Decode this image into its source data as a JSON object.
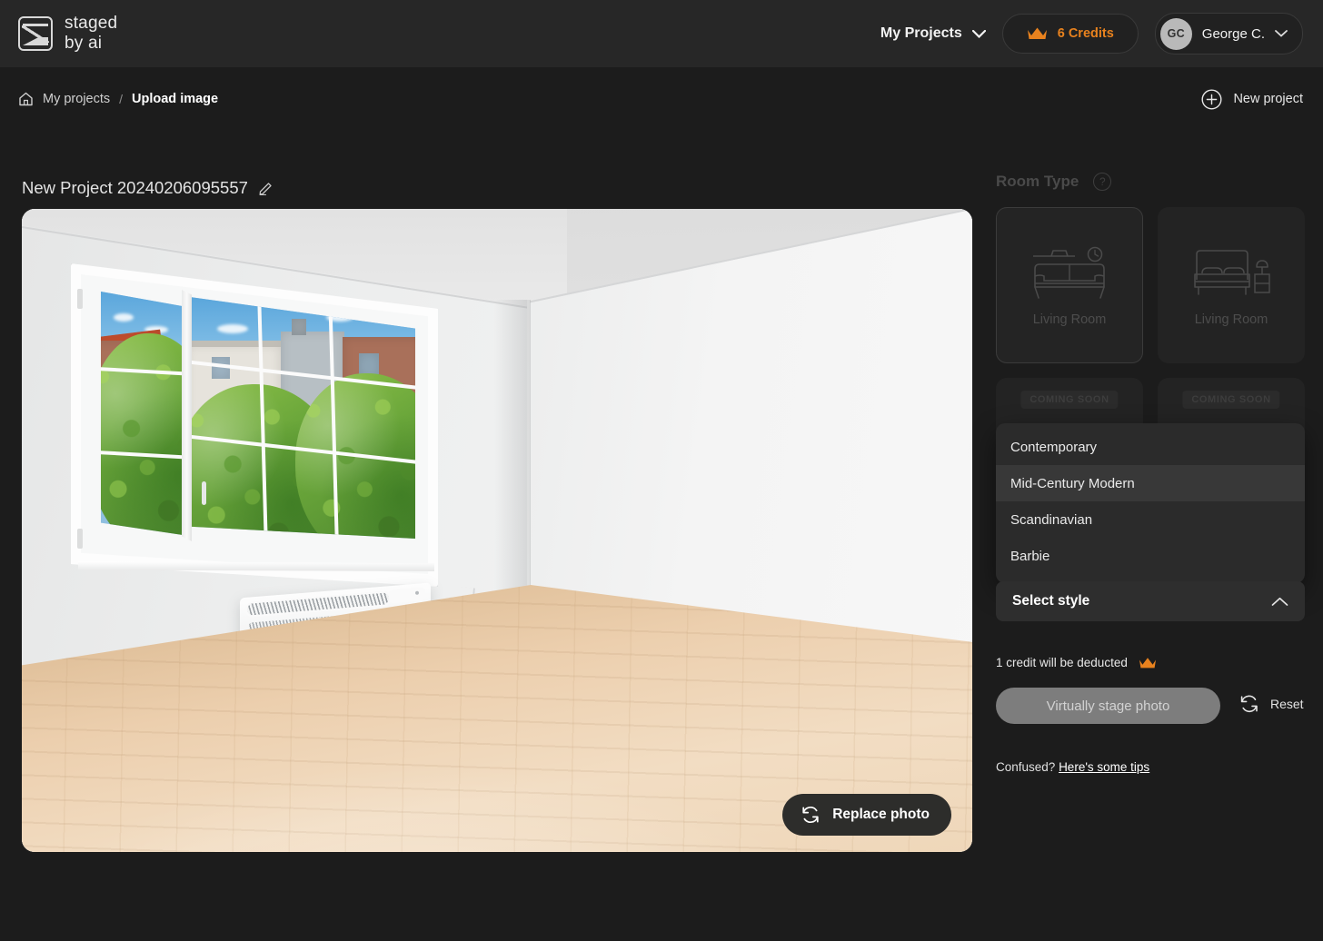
{
  "topbar": {
    "logo_line1": "staged",
    "logo_line2": "by ai",
    "my_projects": "My Projects",
    "credits": "6 Credits",
    "avatar_initials": "GC",
    "user_name": "George C."
  },
  "breadcrumb": {
    "home_icon": "home-icon",
    "root": "My projects",
    "separator": "/",
    "current": "Upload image",
    "new_project": "New project",
    "new_project_icon": "plus-circle-icon"
  },
  "project": {
    "title": "New Project 20240206095557",
    "edit_icon": "pencil-icon"
  },
  "photo": {
    "replace_label": "Replace photo",
    "replace_icon": "refresh-icon"
  },
  "panel": {
    "room_type_title": "Room Type",
    "help_icon": "question-mark-icon",
    "help_glyph": "?",
    "coming_soon": "COMING SOON",
    "cards": [
      {
        "label": "Living Room",
        "icon": "sofa-icon",
        "selected": true
      },
      {
        "label": "Living Room",
        "icon": "bed-icon",
        "selected": false
      },
      {
        "label": "",
        "icon": "kitchen-icon",
        "selected": false
      },
      {
        "label": "",
        "icon": "dining-icon",
        "selected": false
      }
    ]
  },
  "style_select": {
    "button_label": "Select style",
    "chevron_icon": "chevron-up-icon",
    "options": [
      {
        "label": "Contemporary",
        "hover": false
      },
      {
        "label": "Mid-Century Modern",
        "hover": true
      },
      {
        "label": "Scandinavian",
        "hover": false
      },
      {
        "label": "Barbie",
        "hover": false
      }
    ]
  },
  "actions": {
    "credit_note": "1 credit will be deducted",
    "crown_icon": "crown-icon",
    "stage_button": "Virtually stage photo",
    "reset_label": "Reset",
    "reset_icon": "refresh-icon",
    "tips_prefix": "Confused? ",
    "tips_link": "Here's some tips"
  },
  "colors": {
    "accent_orange": "#e8821e",
    "page_bg": "#1c1c1c",
    "topbar_bg": "#272727",
    "panel_card_bg": "#232323",
    "menu_bg": "#2b2b2b",
    "menu_hover_bg": "#383838"
  }
}
